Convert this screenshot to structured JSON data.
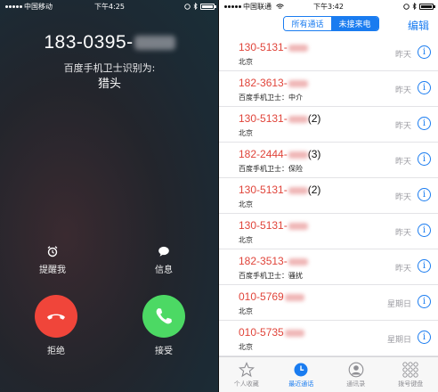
{
  "incoming": {
    "status": {
      "carrier": "中国移动",
      "time": "下午4:25"
    },
    "number_visible": "183-0395-",
    "caller_id_label": "百度手机卫士识别为:",
    "caller_tag": "猎头",
    "actions": {
      "remind_label": "提醒我",
      "message_label": "信息"
    },
    "decline_label": "拒绝",
    "accept_label": "接受",
    "colors": {
      "decline": "#f0453a",
      "accept": "#4cd964"
    }
  },
  "recents": {
    "status": {
      "carrier": "中国联通",
      "time": "下午3:42"
    },
    "segment": {
      "all_label": "所有通话",
      "missed_label": "未接来电",
      "selected": "未接来电"
    },
    "edit_label": "编辑",
    "info_symbol": "i",
    "rows": [
      {
        "number": "130-5131-",
        "count": "",
        "sub": "北京",
        "when": "昨天"
      },
      {
        "number": "182-3613-",
        "count": "",
        "sub": "百度手机卫士：中介",
        "when": "昨天"
      },
      {
        "number": "130-5131-",
        "count": "(2)",
        "sub": "北京",
        "when": "昨天"
      },
      {
        "number": "182-2444-",
        "count": "(3)",
        "sub": "百度手机卫士：保险",
        "when": "昨天"
      },
      {
        "number": "130-5131-",
        "count": "(2)",
        "sub": "北京",
        "when": "昨天"
      },
      {
        "number": "130-5131-",
        "count": "",
        "sub": "北京",
        "when": "昨天"
      },
      {
        "number": "182-3513-",
        "count": "",
        "sub": "百度手机卫士：骚扰",
        "when": "昨天"
      },
      {
        "number": "010-5769",
        "count": "",
        "sub": "北京",
        "when": "星期日"
      },
      {
        "number": "010-5735",
        "count": "",
        "sub": "北京",
        "when": "星期日"
      }
    ],
    "tabs": [
      {
        "label": "个人收藏",
        "icon": "star-icon",
        "active": false
      },
      {
        "label": "最近通话",
        "icon": "clock-icon",
        "active": true
      },
      {
        "label": "通讯录",
        "icon": "person-icon",
        "active": false
      },
      {
        "label": "拨号键盘",
        "icon": "keypad-icon",
        "active": false
      }
    ],
    "accent_color": "#1a7cf0",
    "missed_color": "#e0443a"
  }
}
